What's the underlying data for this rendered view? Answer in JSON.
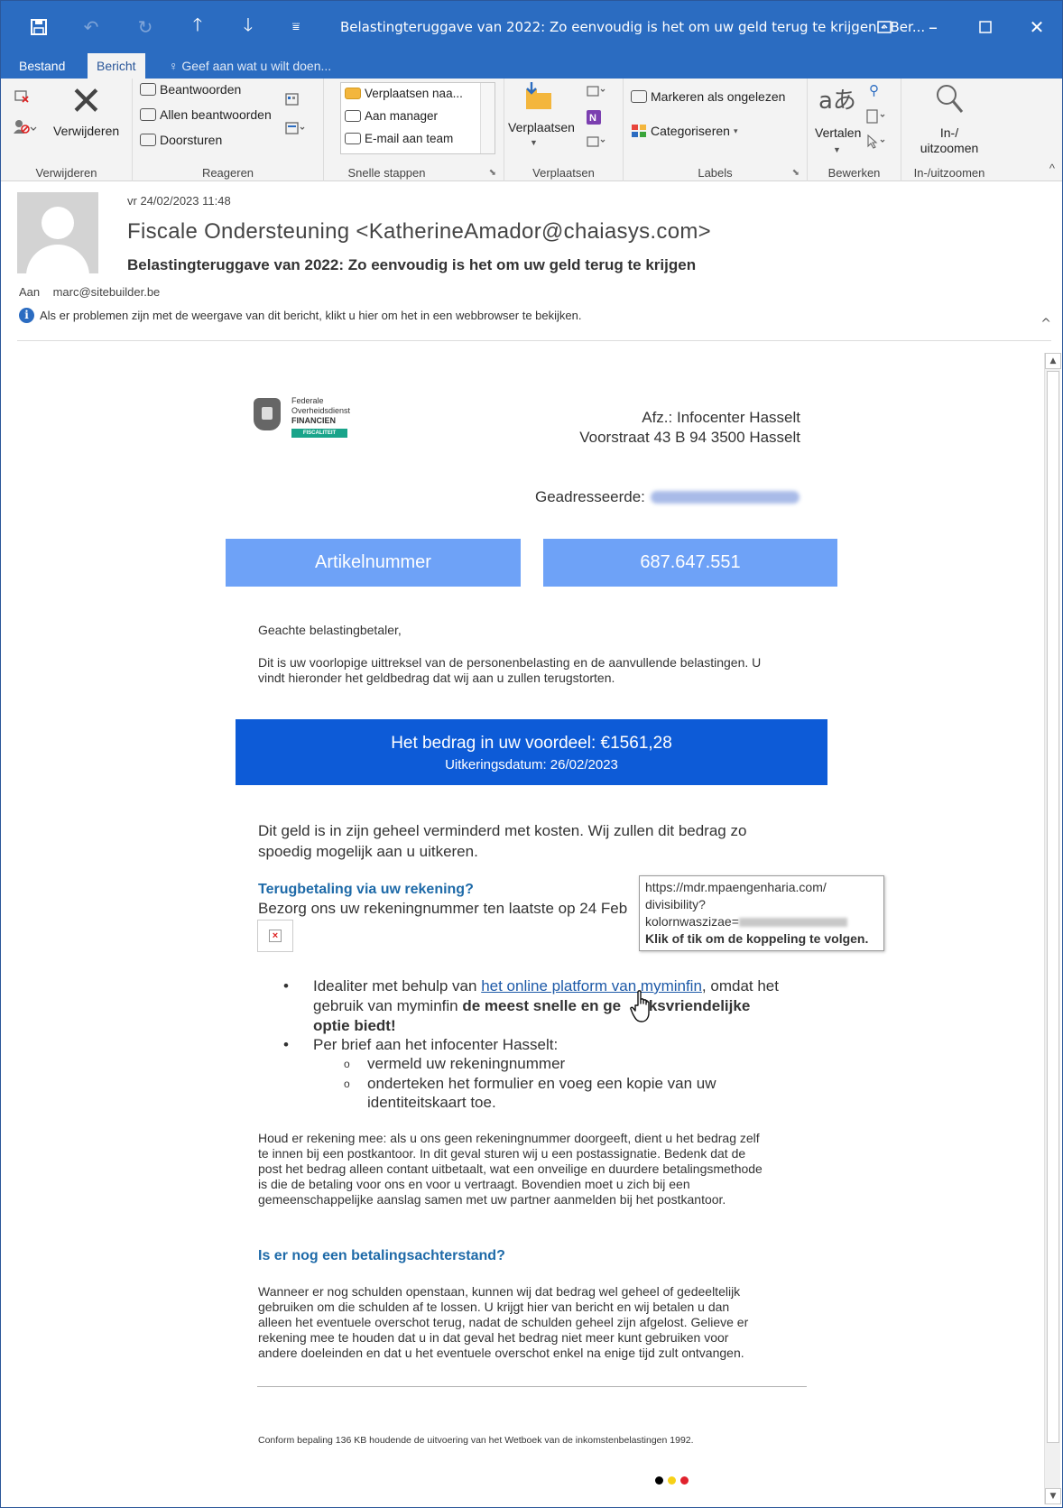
{
  "window": {
    "title": "Belastingteruggave van 2022: Zo eenvoudig is het om uw geld terug te krijgen - Ber...",
    "minimize": "–",
    "restore": "❐",
    "close": "✕"
  },
  "tabs": {
    "file": "Bestand",
    "message": "Bericht",
    "tell_me": "Geef aan wat u wilt doen..."
  },
  "ribbon": {
    "delete_group": {
      "label": "Verwijderen",
      "delete_button": "Verwijderen"
    },
    "respond_group": {
      "label": "Reageren",
      "reply": "Beantwoorden",
      "reply_all": "Allen beantwoorden",
      "forward": "Doorsturen"
    },
    "quicksteps_group": {
      "label": "Snelle stappen",
      "move_to": "Verplaatsen naa...",
      "to_manager": "Aan manager",
      "team_email": "E-mail aan team"
    },
    "move_group": {
      "label": "Verplaatsen",
      "move": "Verplaatsen"
    },
    "tags_group": {
      "label": "Labels",
      "mark_unread": "Markeren als ongelezen",
      "categorize": "Categoriseren"
    },
    "editing_group": {
      "label": "Bewerken",
      "translate": "Vertalen"
    },
    "zoom_group": {
      "label": "In-/uitzoomen",
      "zoom_line1": "In-/",
      "zoom_line2": "uitzoomen"
    }
  },
  "header": {
    "date": "vr 24/02/2023 11:48",
    "from": "Fiscale Ondersteuning <KatherineAmador@chaiasys.com>",
    "subject": "Belastingteruggave van 2022: Zo eenvoudig is het om uw geld terug te krijgen",
    "to_label": "Aan",
    "to_value": "marc@sitebuilder.be",
    "info_bar": "Als er problemen zijn met de weergave van dit bericht, klikt u hier om het in een webbrowser te bekijken."
  },
  "body": {
    "logo": {
      "line1": "Federale",
      "line2": "Overheidsdienst",
      "line3": "FINANCIEN",
      "badge": "FISCALITEIT"
    },
    "sender_address": {
      "line1": "Afz.: Infocenter Hasselt",
      "line2": "Voorstraat 43 B 94 3500 Hasselt"
    },
    "addressee_label": "Geadresseerde:",
    "article_label": "Artikelnummer",
    "article_number": "687.647.551",
    "greeting": "Geachte belastingbetaler,",
    "intro_line1": "Dit is uw voorlopige uittreksel van de personenbelasting en de aanvullende belastingen. U",
    "intro_line2": "vindt hieronder het geldbedrag dat wij aan u zullen terugstorten.",
    "amount_line": "Het bedrag in uw voordeel: €1561,28",
    "payout_line": "Uitkeringsdatum: 26/02/2023",
    "costs_line1": "Dit geld is in zijn geheel verminderd met kosten. Wij zullen dit bedrag zo",
    "costs_line2": "spoedig mogelijk aan u uitkeren.",
    "refund_heading": "Terugbetaling via uw rekening?",
    "refund_text": "Bezorg ons uw rekeningnummer ten laatste op 24 Feb",
    "bullet1_prefix": "Idealiter met behulp van",
    "bullet1_link": "het online platform van myminfin",
    "bullet1_suffix": ", omdat het",
    "bullet1_line2_prefix": "gebruik van myminfin",
    "bullet1_bold_a": "de meest snelle en ge",
    "bullet1_bold_b": "iksvriendelijke",
    "bullet1_bold_line3": "optie biedt!",
    "bullet2": "Per brief aan het infocenter Hasselt:",
    "sub1": "vermeld uw rekeningnummer",
    "sub2_line1": "onderteken het formulier en voeg een kopie van uw",
    "sub2_line2": "identiteitskaart toe.",
    "note_lines": [
      "Houd er rekening mee: als u ons geen rekeningnummer doorgeeft, dient u het bedrag zelf",
      "te innen bij een postkantoor. In dit geval sturen wij u een postassignatie. Bedenk dat de",
      "post het bedrag alleen contant uitbetaalt, wat een onveilige en duurdere betalingsmethode",
      "is die de betaling voor ons en voor u vertraagt. Bovendien moet u zich bij een",
      "gemeenschappelijke aanslag samen met uw partner aanmelden bij het postkantoor."
    ],
    "arrears_heading": "Is er nog een betalingsachterstand?",
    "arrears_lines": [
      "Wanneer er nog schulden openstaan, kunnen wij dat bedrag wel geheel of gedeeltelijk",
      "gebruiken om die schulden af te lossen. U krijgt hier van bericht en wij betalen u dan",
      "alleen het eventuele overschot terug, nadat de schulden geheel zijn afgelost. Gelieve er",
      "rekening mee te houden dat u in dat geval het bedrag niet meer kunt gebruiken voor",
      "andere doeleinden en dat u het eventuele overschot enkel na enige tijd zult ontvangen."
    ],
    "footer": "Conform bepaling 136 KB houdende de uitvoering van het Wetboek van de inkomstenbelastingen 1992.",
    "dot_colors": [
      "#000000",
      "#f7d117",
      "#e0222d"
    ]
  },
  "tooltip": {
    "line1": "https://mdr.mpaengenharia.com/",
    "line2": "divisibility?",
    "line3_prefix": "kolornwaszizae=",
    "action": "Klik of tik om de koppeling te volgen."
  }
}
